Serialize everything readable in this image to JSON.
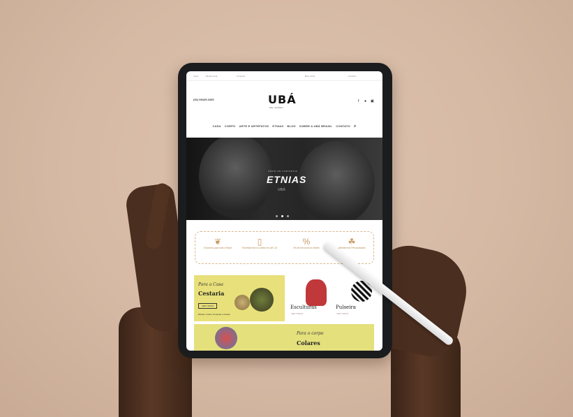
{
  "topbar": {
    "links": [
      "Início",
      "Minha conta",
      "Compras"
    ],
    "right": "Bem-vindo",
    "cart": "Carrinho"
  },
  "header": {
    "phone": "(92) 99425-3465",
    "phone_sub": "",
    "logo": "UBÁ",
    "logo_sub": "arte • produtos"
  },
  "nav": {
    "items": [
      "CASA",
      "CORPO",
      "ARTE E ARTEFATOS",
      "ETNIAS",
      "BLOG",
      "SOBRE A UBÁ BRASIL",
      "CONTATO"
    ],
    "search_icon": "search-icon"
  },
  "hero": {
    "kicker": "SÉRIE DE CAMISETAS",
    "title": "ETNIAS",
    "small_logo": "UBÁ"
  },
  "benefits": [
    {
      "icon": "leaf-icon",
      "text": "Enviamos para todo o Brasil"
    },
    {
      "icon": "card-icon",
      "text": "Parcelamento no cartão em até 12x"
    },
    {
      "icon": "discount-icon",
      "text": "5% de Desconto no Boleto"
    },
    {
      "icon": "handshake-icon",
      "text": "Atendimento Personalizado"
    }
  ],
  "tiles": [
    {
      "category": "Para a Casa",
      "title": "Cestaria",
      "button": "VER TODAS",
      "caption": "Bolsas, Urutus, Peneiras e Cestas",
      "bg": "#e8e07a"
    },
    {
      "category": "",
      "title": "Esculturas",
      "caption": "VER TODAS",
      "bg": "#ffffff"
    },
    {
      "category": "",
      "title": "Pulseira",
      "caption": "VER TODAS",
      "bg": "#ffffff"
    },
    {
      "category": "Para o corpo",
      "title": "Colares",
      "bg": "#e4e07c"
    }
  ],
  "colors": {
    "accent": "#c79b62",
    "dark": "#1b1c1e",
    "wall": "#d6bba6"
  }
}
